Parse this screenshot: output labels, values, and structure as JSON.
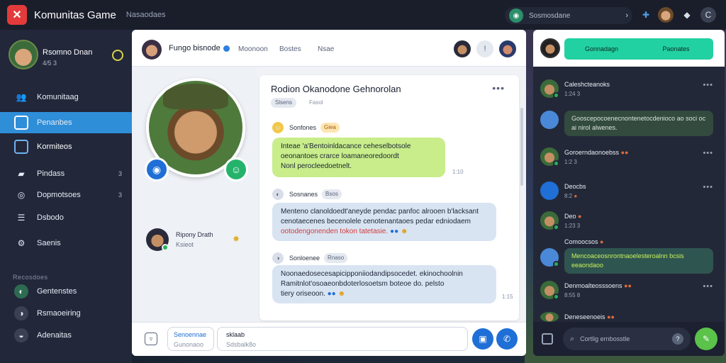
{
  "app": {
    "title": "Komunitas Game",
    "subtitle": "Nasaodaes",
    "search_placeholder": "Sosmosdane",
    "colors": {
      "accent": "#2f8ed8",
      "brand": "#e33b3b",
      "teal": "#22d1a2"
    }
  },
  "profile": {
    "name": "Rsomno Dnan",
    "sub": "4/5 3"
  },
  "nav": [
    {
      "label": "Komunitaag",
      "icon": "people-icon",
      "badge": ""
    },
    {
      "label": "Penanbes",
      "icon": "chat-icon",
      "badge": ""
    },
    {
      "label": "Kormiteos",
      "icon": "card-icon",
      "badge": ""
    },
    {
      "label": "Pindass",
      "icon": "folder-icon",
      "badge": "3"
    },
    {
      "label": "Dopmotsoes",
      "icon": "gamepad-icon",
      "badge": "3"
    },
    {
      "label": "Dsbodo",
      "icon": "list-icon",
      "badge": ""
    },
    {
      "label": "Saenis",
      "icon": "settings-icon",
      "badge": ""
    }
  ],
  "section_header": "Recosdoes",
  "groups": [
    {
      "label": "Gentenstes"
    },
    {
      "label": "Rsmaoeiring"
    },
    {
      "label": "Adenaitas"
    }
  ],
  "chat_header": {
    "name": "Fungo bisnode",
    "tabs": [
      "Moonoon",
      "Bostes",
      "Nsae"
    ]
  },
  "hero_user": {
    "name": "Ripony Drath",
    "sub": "Ksieot"
  },
  "thread": {
    "title": "Rodion Okanodone Gehnorolan",
    "chip": "Slsens",
    "chip2": "Fasol",
    "messages": [
      {
        "author": "Sonfones",
        "tag": "Giea",
        "lines": [
          "Inteae 'a'Bentoinldacance ceheselbotsole",
          "oeonantoes crarce loamaneoredoordt",
          "Nonl perocleedoetnelt."
        ],
        "time": "1:10"
      },
      {
        "author": "Sosnanes",
        "tag": "Bsos",
        "lines": [
          "Menteno clanoldoedt'aneyde pendac panfoc alrooen b'lacksant",
          "cenotaecenes becenolele cenotenantaoes pedar edniodaem"
        ],
        "line_red": "ootodengonenden tokon tatetasie.",
        "time": ""
      },
      {
        "author": "Sonloenee",
        "tag": "Rnaso",
        "lines": [
          "Noonaedosecesapicipponiiodandipsocedet. ekinochoolnin",
          "Ramitnlot'osoaeonbdoterlosoetsm boteoe do. pelsto",
          "tiery oriseoon."
        ],
        "time": "1:15"
      }
    ]
  },
  "composer": {
    "select_top": "Senoennae",
    "select_bottom": "Gunonaoo",
    "input_top": "sklaab",
    "input_bottom": "Sdsbalk8o"
  },
  "right_panel": {
    "tabs": [
      "Gonnadagn",
      "Paonates"
    ],
    "items": [
      {
        "type": "user",
        "name": "Caleshcteanoks",
        "sub": "1:24 3"
      },
      {
        "type": "bubble",
        "text": "Gooscepocoenecnontenetocdenioco ao soci oc ai nirol alwenes.",
        "teal": false
      },
      {
        "type": "user",
        "name": "Goroerndaonoebss",
        "sub": "1:2 3"
      },
      {
        "type": "user",
        "name": "Deocbs",
        "sub": "8:2"
      },
      {
        "type": "user",
        "name": "Deo",
        "sub": "1:23 3"
      },
      {
        "type": "label",
        "name": "Comoocsos"
      },
      {
        "type": "bubble",
        "text": "Mencoaceosnrontnaoelesteroalnn bcsis eeaondaoo",
        "teal": true
      },
      {
        "type": "user",
        "name": "Denmoalteosssoens",
        "sub": "8:55 8"
      },
      {
        "type": "user",
        "name": "Deneseenoeis",
        "sub": ""
      }
    ],
    "search_placeholder": "Cortlig ernbosstle"
  }
}
